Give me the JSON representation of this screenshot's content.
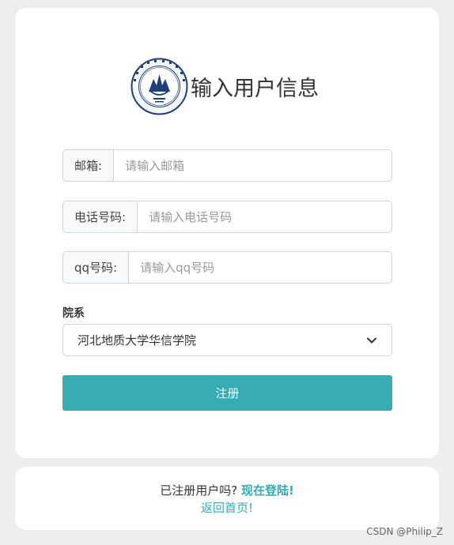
{
  "header": {
    "title": "输入用户信息",
    "logo_icon": "university-seal-logo"
  },
  "form": {
    "email": {
      "label": "邮箱:",
      "placeholder": "请输入邮箱",
      "value": ""
    },
    "phone": {
      "label": "电话号码:",
      "placeholder": "请输入电话号码",
      "value": ""
    },
    "qq": {
      "label": "qq号码:",
      "placeholder": "请输入qq号码",
      "value": ""
    },
    "department": {
      "label": "院系",
      "selected": "河北地质大学华信学院",
      "options": [
        "河北地质大学华信学院"
      ]
    },
    "register_label": "注册"
  },
  "footer": {
    "question": "已注册用户吗?",
    "login_link": "现在登陆!",
    "back_link": "返回首页!"
  },
  "watermark": "CSDN @Philip_Z",
  "colors": {
    "accent": "#35abb3",
    "background": "#eeeeee",
    "card": "#ffffff",
    "border": "#ced4da"
  }
}
